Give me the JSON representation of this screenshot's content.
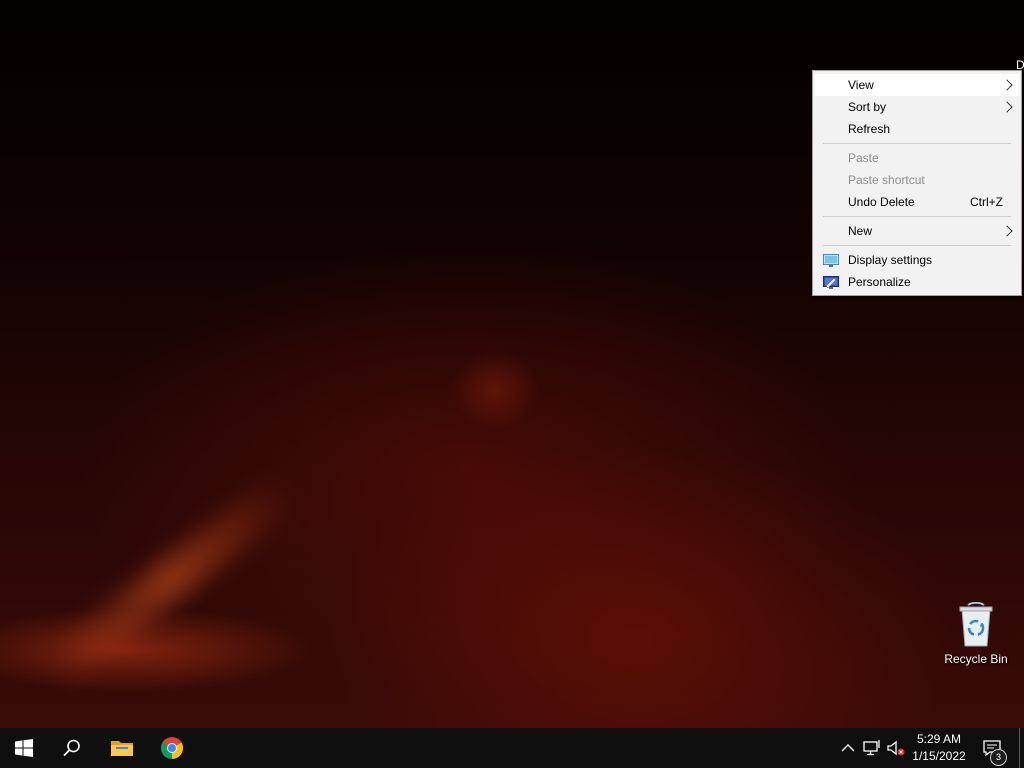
{
  "desktop": {
    "corner_label": "D",
    "recycle_bin": {
      "label": "Recycle Bin"
    }
  },
  "context_menu": {
    "items": [
      {
        "label": "View",
        "submenu": true,
        "highlighted": true
      },
      {
        "label": "Sort by",
        "submenu": true
      },
      {
        "label": "Refresh"
      },
      {
        "label": "Paste",
        "disabled": true
      },
      {
        "label": "Paste shortcut",
        "disabled": true
      },
      {
        "label": "Undo Delete",
        "shortcut": "Ctrl+Z"
      },
      {
        "label": "New",
        "submenu": true
      },
      {
        "label": "Display settings",
        "icon": "display-settings-icon"
      },
      {
        "label": "Personalize",
        "icon": "personalize-icon"
      }
    ]
  },
  "taskbar": {
    "pinned": [
      {
        "name": "start",
        "icon": "windows-logo-icon"
      },
      {
        "name": "search",
        "icon": "search-icon"
      },
      {
        "name": "file-explorer",
        "icon": "folder-icon"
      },
      {
        "name": "chrome",
        "icon": "chrome-icon"
      }
    ],
    "tray": {
      "icons": [
        "chevron-up-icon",
        "network-icon",
        "volume-muted-icon"
      ],
      "time": "5:29 AM",
      "date": "1/15/2022",
      "notification_count": "3"
    }
  },
  "colors": {
    "taskbar_bg": "#0f0f0f",
    "menu_bg": "#f2f2f2",
    "menu_highlight": "#ffffff",
    "disabled_text": "#8d8d8d"
  }
}
